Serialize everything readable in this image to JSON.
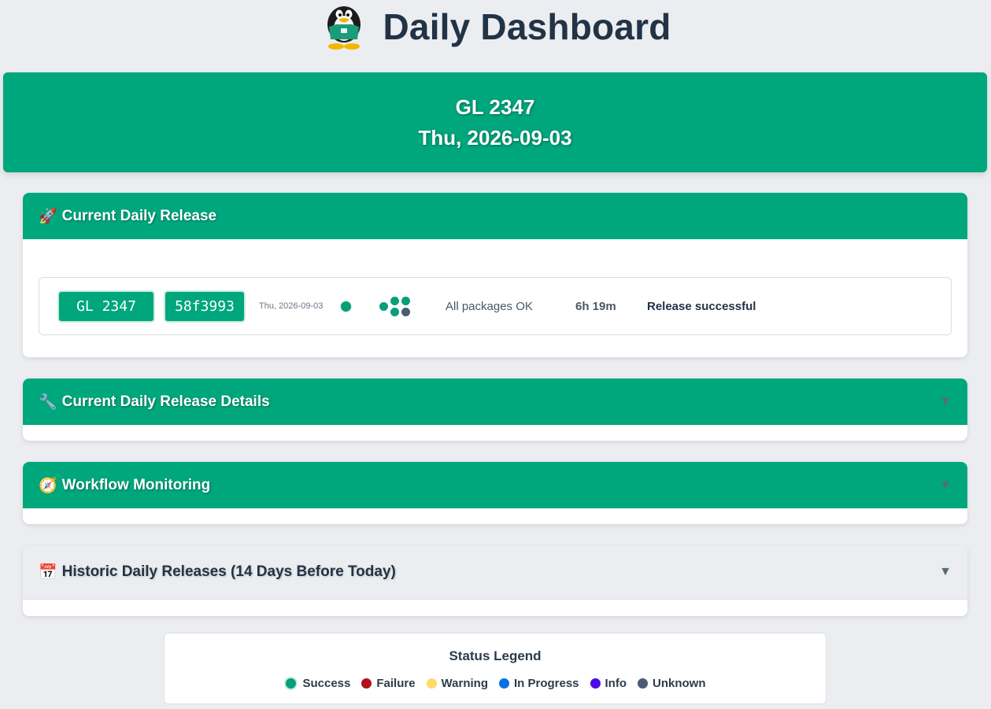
{
  "header": {
    "title": "Daily Dashboard",
    "logo_icon": "tux-penguin-icon"
  },
  "hero": {
    "build": "GL 2347",
    "date": "Thu, 2026-09-03"
  },
  "sections": {
    "current": {
      "emoji": "🚀",
      "title": "Current Daily Release"
    },
    "details": {
      "emoji": "🔧",
      "title": "Current Daily Release Details",
      "toggle": "▼"
    },
    "workflow": {
      "emoji": "🧭",
      "title": "Workflow Monitoring",
      "toggle": "▼"
    },
    "historic": {
      "emoji": "📅",
      "title": "Historic Daily Releases (14 Days Before Today)",
      "toggle": "▼"
    }
  },
  "release": {
    "version": "GL 2347",
    "commit": "58f3993",
    "date": "Thu, 2026-09-03",
    "status": "success",
    "packages_text": "All packages OK",
    "duration": "6h 19m",
    "result": "Release successful"
  },
  "legend": {
    "title": "Status Legend",
    "items": [
      {
        "label": "Success",
        "color": "#079e7a"
      },
      {
        "label": "Failure",
        "color": "#b0111a"
      },
      {
        "label": "Warning",
        "color": "#ffd966"
      },
      {
        "label": "In Progress",
        "color": "#0a6fe6"
      },
      {
        "label": "Info",
        "color": "#4b0ae6"
      },
      {
        "label": "Unknown",
        "color": "#4a5b74"
      }
    ]
  },
  "colors": {
    "accent": "#00a67c",
    "success": "#079e7a",
    "unknown": "#4a5b74"
  }
}
